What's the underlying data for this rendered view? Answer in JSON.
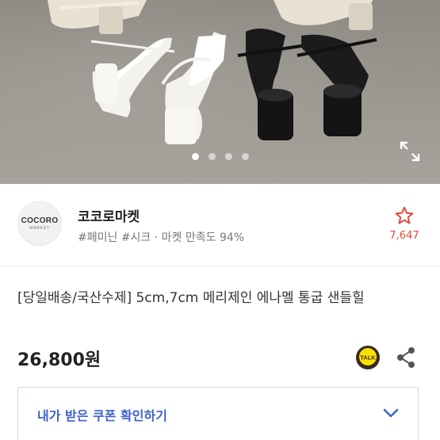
{
  "image": {
    "pagination": {
      "total": 4,
      "active_index": 0
    }
  },
  "seller": {
    "logo_text": "COCORO",
    "logo_subtext": "MARKET",
    "name": "코코로마켓",
    "tags": "#페미닌 #시크 · 마켓 만족도 94%",
    "favorite_count": "7,647"
  },
  "product": {
    "title": "[당일배송/국산수제] 5cm,7cm 메리제인 에나멜 통굽 샌들힐",
    "price": "26,800원",
    "talk_label": "TALK"
  },
  "coupon": {
    "label": "내가 받은 쿠폰 확인하기"
  },
  "colors": {
    "accent_red": "#e8453c",
    "link_blue": "#3d62c9",
    "talk_yellow": "#3a2a1e"
  },
  "icons": {
    "favorite": "star-outline-icon",
    "talk": "kakao-talk-icon",
    "share": "share-icon",
    "expand": "expand-icon",
    "chevron": "chevron-down-icon"
  }
}
